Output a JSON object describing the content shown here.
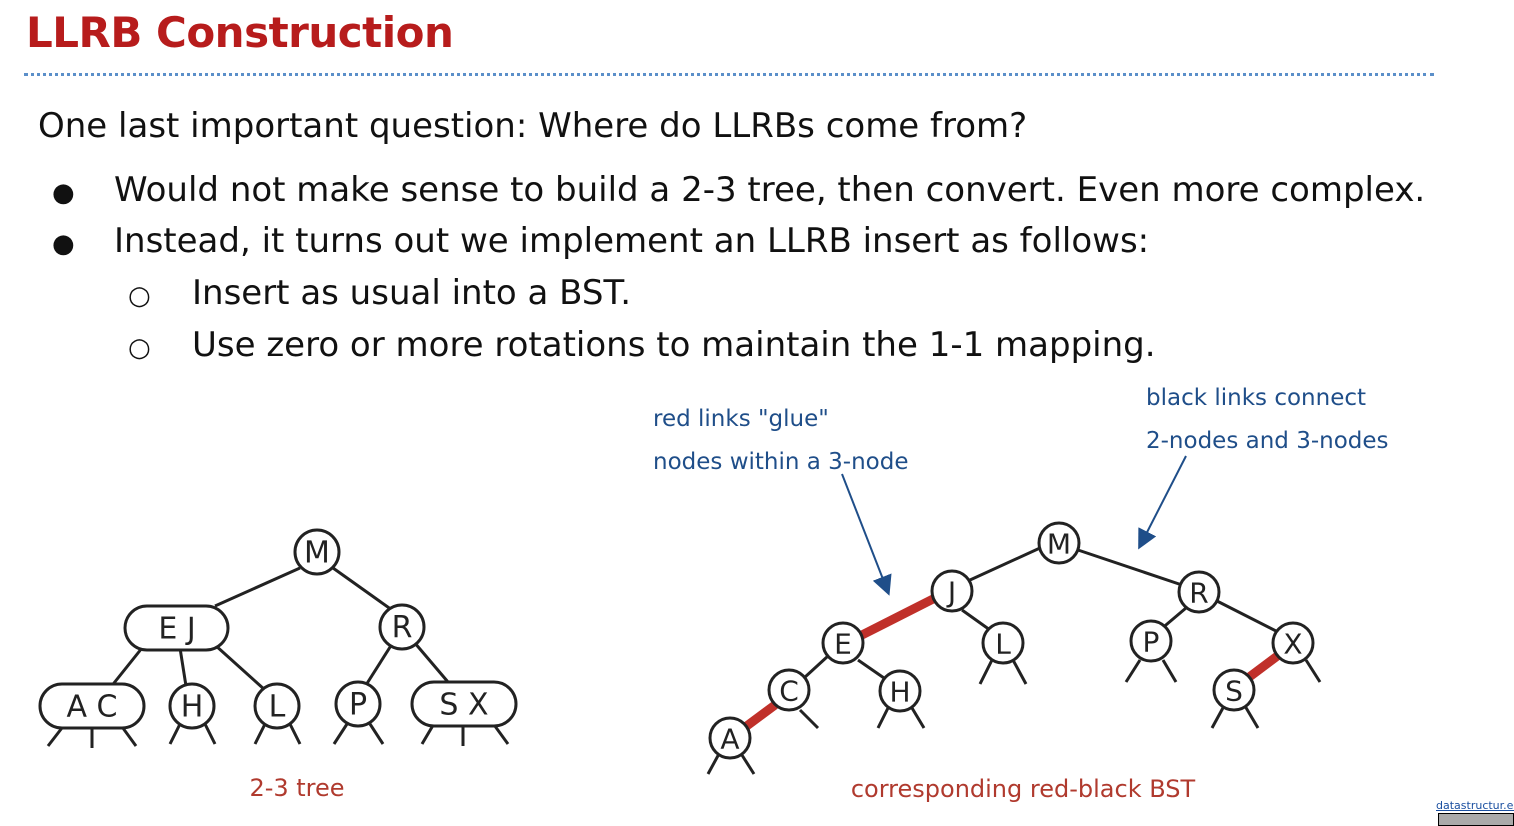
{
  "slide": {
    "title": "LLRB Construction",
    "intro": "One last important question: Where do LLRBs come from?",
    "bullets": [
      "Would not make sense to build a 2-3 tree, then convert. Even more complex.",
      "Instead, it turns out we implement an LLRB insert as follows:"
    ],
    "sub_bullets": [
      "Insert as usual into a BST.",
      "Use zero or more rotations to maintain the 1-1 mapping."
    ],
    "bullet_glyph": "●",
    "sub_bullet_glyph": "○"
  },
  "tree23": {
    "caption": "2-3 tree",
    "nodes": [
      "M",
      "E J",
      "R",
      "A C",
      "H",
      "L",
      "P",
      "S X"
    ]
  },
  "rbtree": {
    "caption": "corresponding red-black BST",
    "nodes": [
      "M",
      "J",
      "R",
      "E",
      "L",
      "P",
      "X",
      "C",
      "H",
      "S",
      "A"
    ],
    "annotation_red": [
      "red links \"glue\"",
      "nodes within a 3-node"
    ],
    "annotation_black": [
      "black links connect",
      "2-nodes and 3-nodes"
    ]
  },
  "colors": {
    "title": "#b71c1c",
    "red_link": "#c0302a",
    "annotation": "#1f4e89",
    "caption": "#b03a2e",
    "divider": "#5b8fc9"
  },
  "footer": {
    "credit": "datastructur.es"
  }
}
